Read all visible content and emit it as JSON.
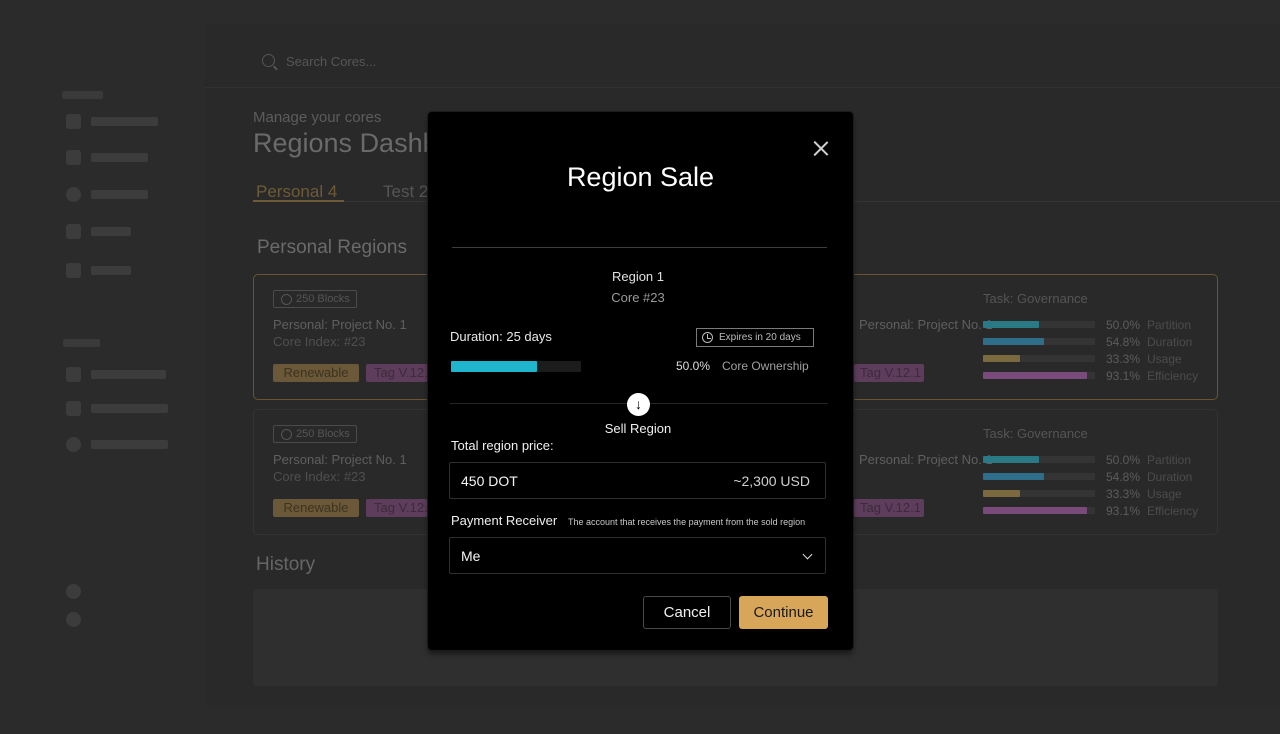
{
  "search": {
    "placeholder": "Search Cores..."
  },
  "header": {
    "subtitle": "Manage your cores",
    "title": "Regions Dashboard"
  },
  "tabs": [
    {
      "label": "Personal 4"
    },
    {
      "label": "Test 2"
    }
  ],
  "section": {
    "title": "Personal Regions"
  },
  "history": {
    "title": "History"
  },
  "cards": [
    {
      "blocks": "250 Blocks",
      "name": "Personal: Project No. 1",
      "core_index": "Core Index: #23",
      "renewable": "Renewable",
      "tag": "Tag V.12.1",
      "name_right": "Personal: Project No. 1",
      "tag_right": "Tag V.12.1",
      "task": "Task: Governance",
      "stats": [
        {
          "value": "50.0%",
          "label": "Partition",
          "fraction": 0.5
        },
        {
          "value": "54.8%",
          "label": "Duration",
          "fraction": 0.548
        },
        {
          "value": "33.3%",
          "label": "Usage",
          "fraction": 0.333
        },
        {
          "value": "93.1%",
          "label": "Efficiency",
          "fraction": 0.931
        }
      ]
    },
    {
      "blocks": "250 Blocks",
      "name": "Personal: Project No. 1",
      "core_index": "Core Index: #23",
      "renewable": "Renewable",
      "tag": "Tag V.12.1",
      "name_right": "Personal: Project No. 1",
      "tag_right": "Tag V.12.1",
      "task": "Task: Governance",
      "stats": [
        {
          "value": "50.0%",
          "label": "Partition",
          "fraction": 0.5
        },
        {
          "value": "54.8%",
          "label": "Duration",
          "fraction": 0.548
        },
        {
          "value": "33.3%",
          "label": "Usage",
          "fraction": 0.333
        },
        {
          "value": "93.1%",
          "label": "Efficiency",
          "fraction": 0.931
        }
      ]
    }
  ],
  "stat_colors": [
    "#2a7a86",
    "#2e6e8a",
    "#7a6a3e",
    "#7a4a7a"
  ],
  "modal": {
    "title": "Region Sale",
    "region_name": "Region 1",
    "region_core": "Core #23",
    "duration": "Duration: 25 days",
    "expires": "Expires in 20 days",
    "ownership_value": "50.0%",
    "ownership_fraction": 0.5,
    "ownership_label": "Core Ownership",
    "sell_label": "Sell Region",
    "price_label": "Total region price:",
    "price_value": "450 DOT",
    "price_usd": "~2,300 USD",
    "receiver_label": "Payment Receiver",
    "receiver_hint": "The account that receives the payment from the sold region",
    "receiver_value": "Me",
    "cancel_label": "Cancel",
    "continue_label": "Continue",
    "accent_color": "#d7a659",
    "progress_color": "#1fb6cd"
  }
}
